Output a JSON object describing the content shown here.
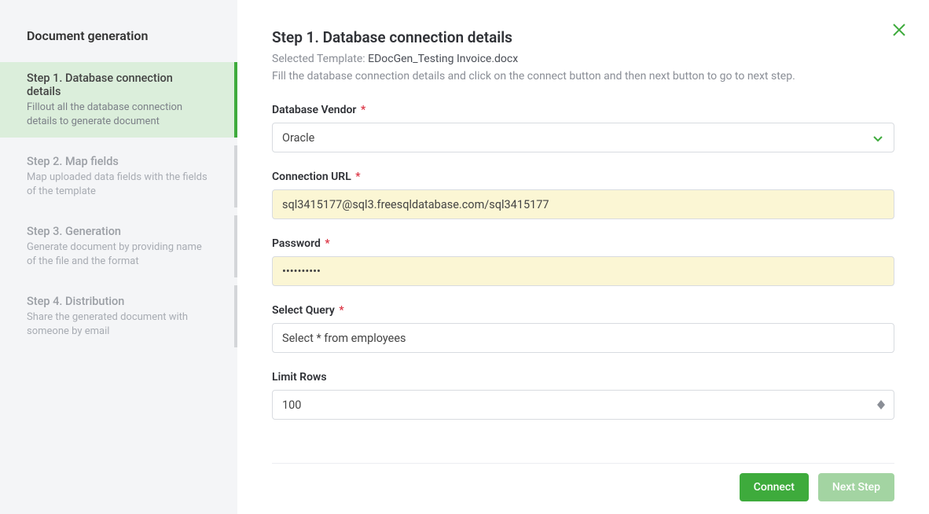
{
  "sidebar": {
    "title": "Document generation",
    "steps": [
      {
        "title": "Step 1. Database connection details",
        "desc": "Fillout all the database connection details to generate document",
        "active": true
      },
      {
        "title": "Step 2. Map fields",
        "desc": "Map uploaded data fields with the fields of the template",
        "active": false
      },
      {
        "title": "Step 3. Generation",
        "desc": "Generate document by providing name of the file and the format",
        "active": false
      },
      {
        "title": "Step 4. Distribution",
        "desc": "Share the generated document with someone by email",
        "active": false
      }
    ]
  },
  "main": {
    "title": "Step 1. Database connection details",
    "selected_template_label": "Selected Template: ",
    "selected_template_name": "EDocGen_Testing Invoice.docx",
    "instructions": "Fill the database connection details and click on the connect button and then next button to go to next step.",
    "fields": {
      "vendor": {
        "label": "Database Vendor",
        "value": "Oracle"
      },
      "connection_url": {
        "label": "Connection URL",
        "value": "sql3415177@sql3.freesqldatabase.com/sql3415177"
      },
      "password": {
        "label": "Password",
        "value": "••••••••••"
      },
      "query": {
        "label": "Select Query",
        "value": "Select * from employees"
      },
      "limit": {
        "label": "Limit Rows",
        "value": "100"
      }
    },
    "buttons": {
      "connect": "Connect",
      "next": "Next Step"
    }
  }
}
